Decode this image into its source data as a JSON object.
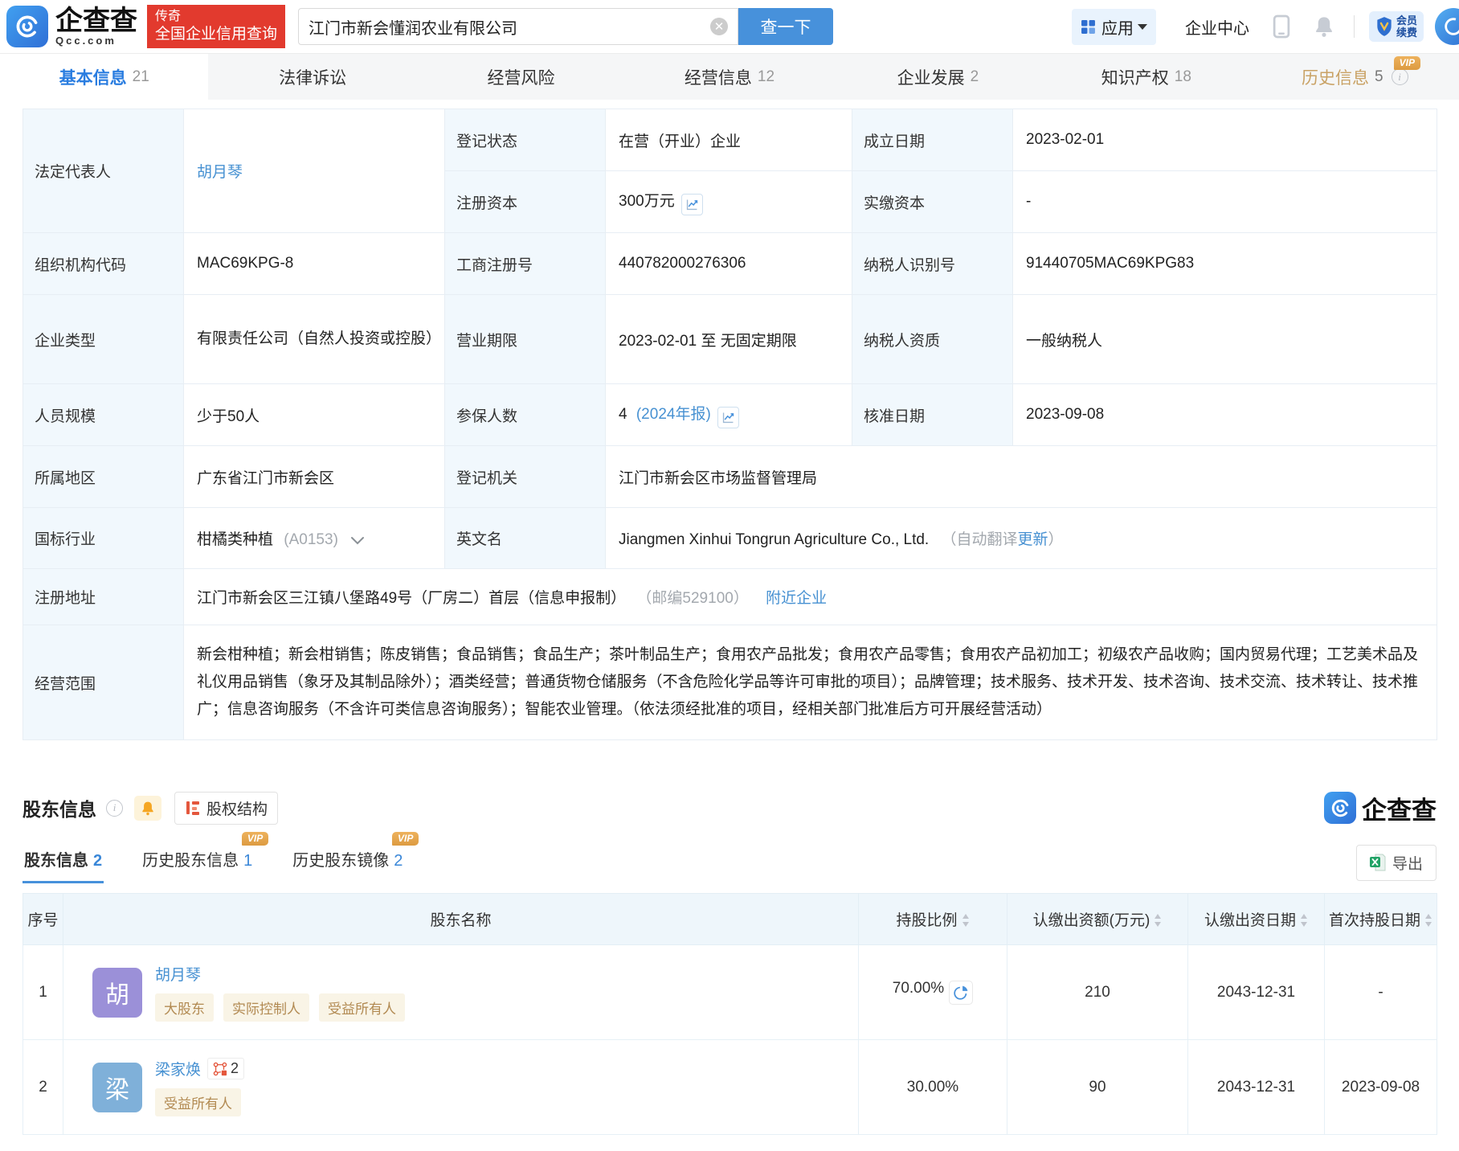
{
  "header": {
    "logo_text": "企查查",
    "logo_sub": "Qcc.com",
    "promo_line1": "传奇",
    "promo_line2": "全国企业信用查询",
    "search_value": "江门市新会懂润农业有限公司",
    "search_button": "查一下",
    "nav_apps": "应用",
    "nav_enterprise_center": "企业中心",
    "vip_renew_line1": "会员",
    "vip_renew_line2": "续费"
  },
  "tabs": [
    {
      "label": "基本信息",
      "count": "21"
    },
    {
      "label": "法律诉讼",
      "count": ""
    },
    {
      "label": "经营风险",
      "count": ""
    },
    {
      "label": "经营信息",
      "count": "12"
    },
    {
      "label": "企业发展",
      "count": "2"
    },
    {
      "label": "知识产权",
      "count": "18"
    },
    {
      "label": "历史信息",
      "count": "5",
      "vip": "VIP"
    }
  ],
  "info": {
    "legal_rep_label": "法定代表人",
    "legal_rep": "胡月琴",
    "reg_status_label": "登记状态",
    "reg_status": "在营（开业）企业",
    "est_date_label": "成立日期",
    "est_date": "2023-02-01",
    "reg_capital_label": "注册资本",
    "reg_capital": "300万元",
    "paid_capital_label": "实缴资本",
    "paid_capital": "-",
    "org_code_label": "组织机构代码",
    "org_code": "MAC69KPG-8",
    "biz_reg_no_label": "工商注册号",
    "biz_reg_no": "440782000276306",
    "taxpayer_id_label": "纳税人识别号",
    "taxpayer_id": "91440705MAC69KPG83",
    "company_type_label": "企业类型",
    "company_type": "有限责任公司（自然人投资或控股）",
    "biz_term_label": "营业期限",
    "biz_term": "2023-02-01 至 无固定期限",
    "taxpayer_quality_label": "纳税人资质",
    "taxpayer_quality": "一般纳税人",
    "staff_size_label": "人员规模",
    "staff_size": "少于50人",
    "insured_label": "参保人数",
    "insured_count": "4",
    "insured_link": "(2024年报)",
    "approval_date_label": "核准日期",
    "approval_date": "2023-09-08",
    "region_label": "所属地区",
    "region": "广东省江门市新会区",
    "reg_authority_label": "登记机关",
    "reg_authority": "江门市新会区市场监督管理局",
    "industry_label": "国标行业",
    "industry": "柑橘类种植",
    "industry_code": "(A0153)",
    "en_name_label": "英文名",
    "en_name": "Jiangmen Xinhui Tongrun Agriculture Co., Ltd.",
    "en_name_note_prefix": "（自动翻译",
    "en_name_update": "更新",
    "en_name_note_suffix": "）",
    "address_label": "注册地址",
    "address": "江门市新会区三江镇八堡路49号（厂房二）首层（信息申报制）",
    "address_zip": "（邮编529100）",
    "address_nearby": "附近企业",
    "biz_scope_label": "经营范围",
    "biz_scope": "新会柑种植；新会柑销售；陈皮销售；食品销售；食品生产；茶叶制品生产；食用农产品批发；食用农产品零售；食用农产品初加工；初级农产品收购；国内贸易代理；工艺美术品及礼仪用品销售（象牙及其制品除外）；酒类经营；普通货物仓储服务（不含危险化学品等许可审批的项目）；品牌管理；技术服务、技术开发、技术咨询、技术交流、技术转让、技术推广；信息咨询服务（不含许可类信息咨询服务）；智能农业管理。（依法须经批准的项目，经相关部门批准后方可开展经营活动）"
  },
  "shareholders": {
    "section_title": "股东信息",
    "structure_button": "股权结构",
    "brand": "企查查",
    "export_label": "导出",
    "tabs": [
      {
        "label": "股东信息",
        "count": "2"
      },
      {
        "label": "历史股东信息",
        "count": "1",
        "vip": "VIP"
      },
      {
        "label": "历史股东镜像",
        "count": "2",
        "vip": "VIP"
      }
    ],
    "columns": [
      "序号",
      "股东名称",
      "持股比例",
      "认缴出资额(万元)",
      "认缴出资日期",
      "首次持股日期"
    ],
    "rows": [
      {
        "no": "1",
        "avatar": "胡",
        "name": "胡月琴",
        "tags": [
          "大股东",
          "实际控制人",
          "受益所有人"
        ],
        "ratio": "70.00%",
        "amount": "210",
        "subscribe_date": "2043-12-31",
        "first_date": "-"
      },
      {
        "no": "2",
        "avatar": "梁",
        "name": "梁家焕",
        "related_count": "2",
        "tags": [
          "受益所有人"
        ],
        "ratio": "30.00%",
        "amount": "90",
        "subscribe_date": "2043-12-31",
        "first_date": "2023-09-08"
      }
    ]
  },
  "icons": {
    "logo": "qcc-ring-icon",
    "search_clear": "clear-circle-icon",
    "apps": "grid-icon",
    "phone": "phone-icon",
    "notifications": "bell-icon",
    "vip_shield": "shield-icon",
    "capital_chart": "trend-chart-icon",
    "insured_chart": "trend-chart-icon",
    "industry_expand": "chevron-down-icon",
    "info": "info-circle-icon",
    "follow_bell": "bell-icon",
    "equity_structure": "org-chart-icon",
    "export_excel": "excel-icon",
    "sort": "sort-arrows-icon",
    "ratio_pie": "pie-chart-icon",
    "related_companies": "network-icon"
  },
  "colors": {
    "brand_blue": "#4791db",
    "link_blue": "#4791d2",
    "active_tab_blue": "#2a7de0",
    "label_bg": "#f1f8fd",
    "promo_red": "#e23a2e",
    "vip_gold": "#dd9b41",
    "history_tab_gold": "#c9a265",
    "tag_text": "#b28a52",
    "tag_bg": "#f9f4e6",
    "avatar_purple": "#9b90d8",
    "avatar_blue": "#7fb0d9",
    "excel_green": "#21a366",
    "bell_orange": "#f5a623",
    "org_icon_orange": "#e4573d"
  }
}
